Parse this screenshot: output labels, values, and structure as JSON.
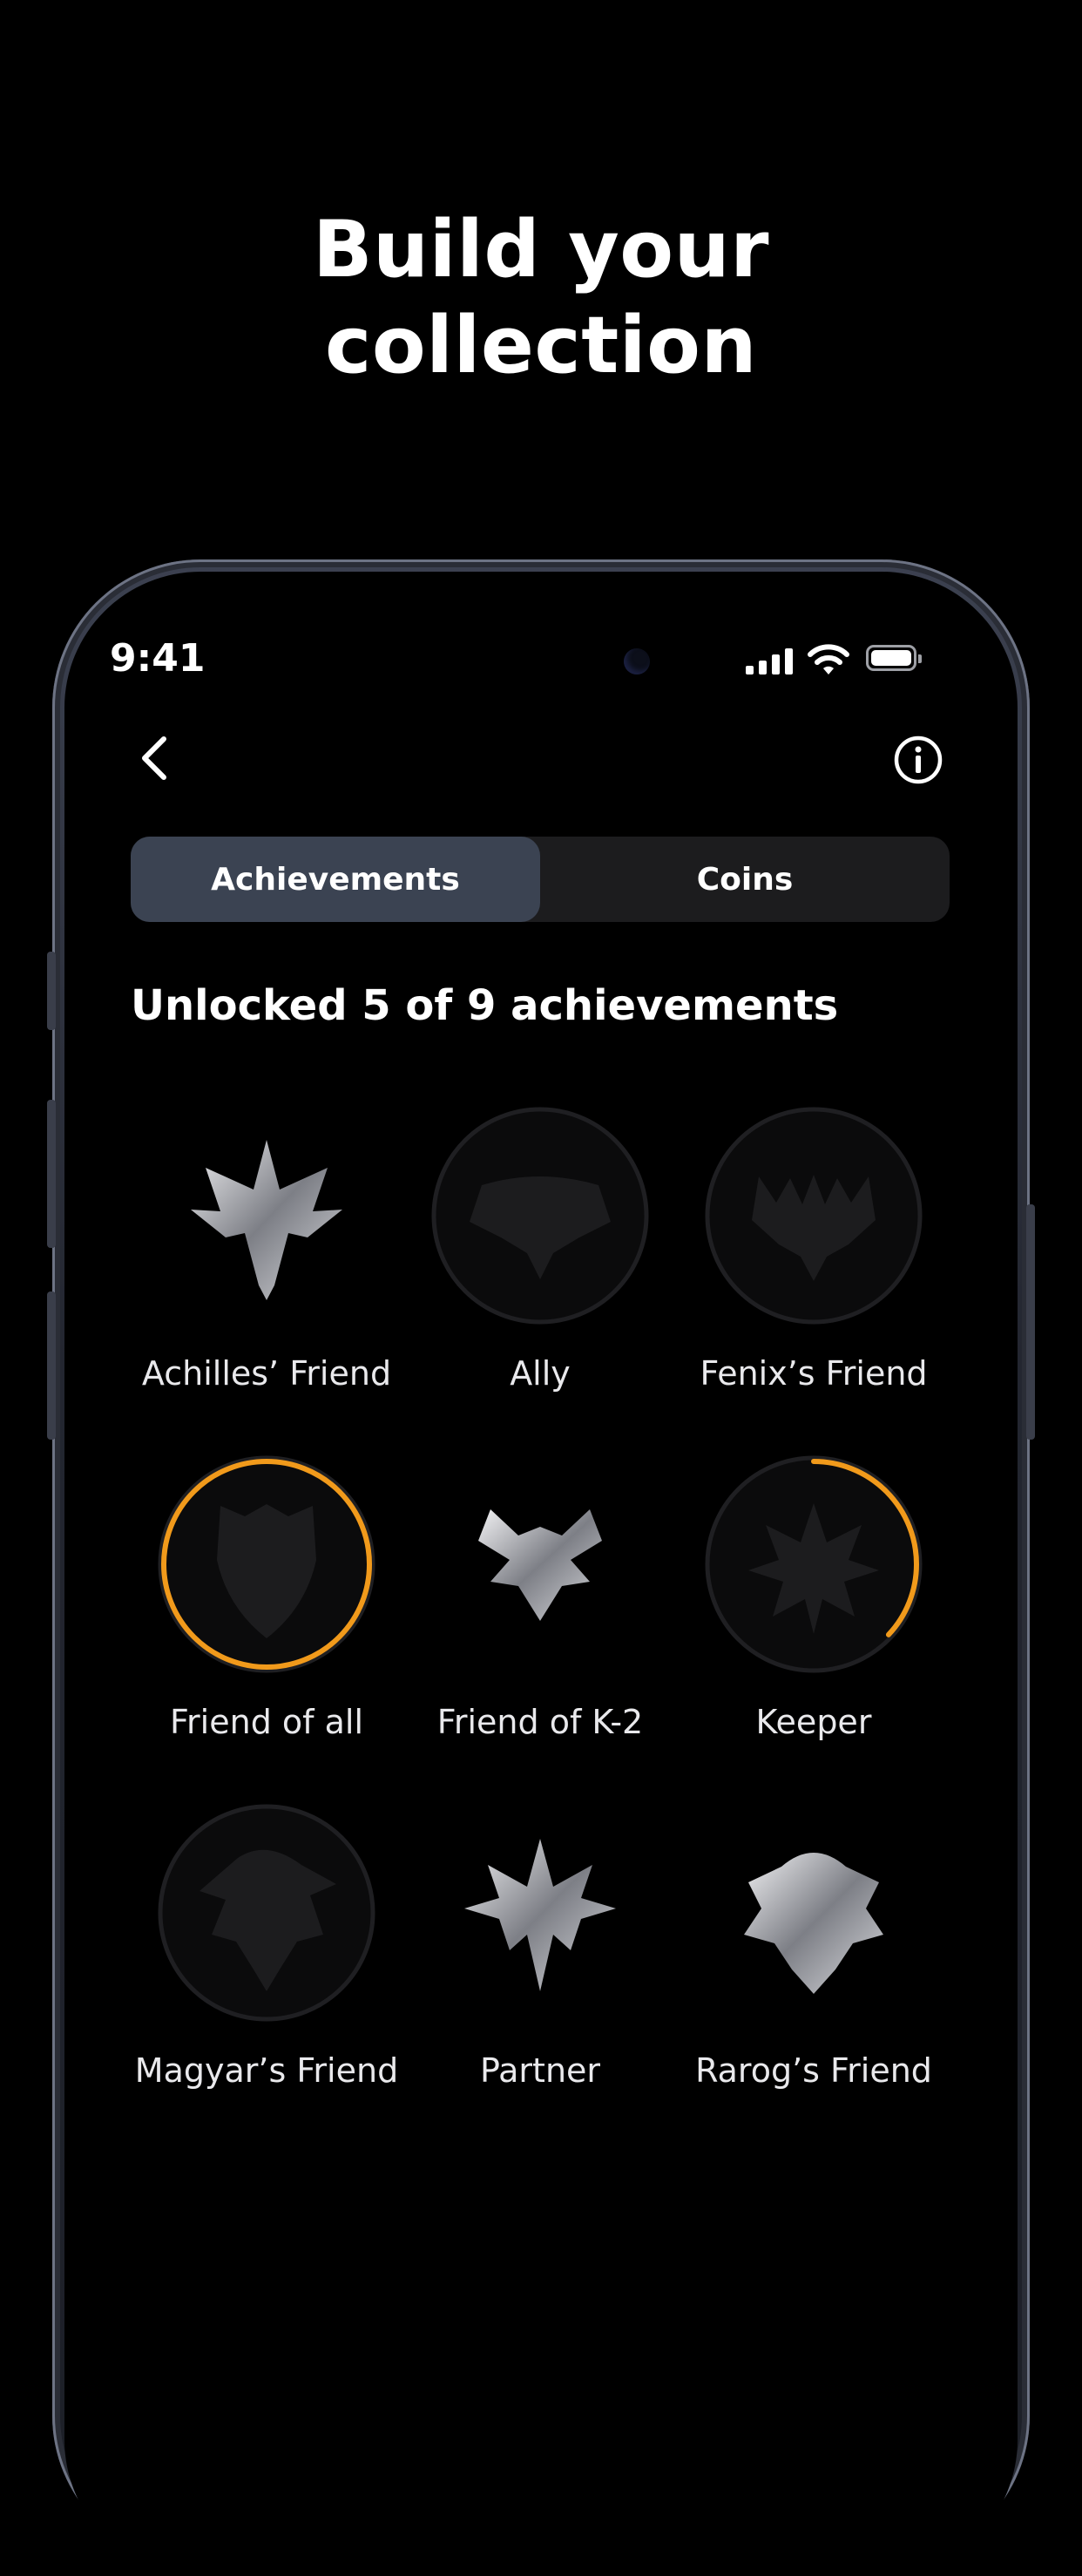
{
  "headline": {
    "line1": "Build your",
    "line2": "collection"
  },
  "status_bar": {
    "time": "9:41"
  },
  "nav": {
    "back_icon": "chevron-left-icon",
    "info_icon": "info-circle-icon"
  },
  "tabs": [
    {
      "label": "Achievements",
      "active": true
    },
    {
      "label": "Coins",
      "active": false
    }
  ],
  "summary": "Unlocked 5 of 9 achievements",
  "colors": {
    "accent": "#f19a1b",
    "tab_active": "#3b4352",
    "tab_bg": "#1c1c1e"
  },
  "achievements": [
    {
      "label": "Achilles’ Friend",
      "state": "unlocked",
      "progress": 1
    },
    {
      "label": "Ally",
      "state": "locked",
      "progress": 0
    },
    {
      "label": "Fenix’s Friend",
      "state": "locked",
      "progress": 0
    },
    {
      "label": "Friend of all",
      "state": "locked",
      "progress": 1
    },
    {
      "label": "Friend of K-2",
      "state": "unlocked",
      "progress": 1
    },
    {
      "label": "Keeper",
      "state": "locked",
      "progress": 0.37
    },
    {
      "label": "Magyar’s Friend",
      "state": "locked",
      "progress": 0
    },
    {
      "label": "Partner",
      "state": "unlocked",
      "progress": 1
    },
    {
      "label": "Rarog’s Friend",
      "state": "unlocked",
      "progress": 1
    }
  ]
}
